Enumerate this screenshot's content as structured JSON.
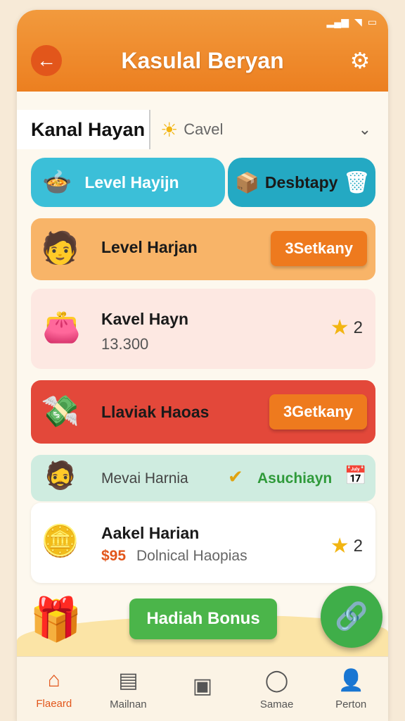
{
  "header": {
    "title": "Kasulal Beryan",
    "back_icon": "arrow-left-icon",
    "settings_icon": "gear-icon"
  },
  "selector": {
    "title": "Kanal Hayan",
    "label": "Cavel",
    "icon": "sun-icon"
  },
  "pills": [
    {
      "label": "Level Hayijn",
      "icon": "bowl-icon",
      "color": "#3bbfd8"
    },
    {
      "label": "Desbtapy",
      "icon": "box-icon",
      "color": "#24a9c3"
    }
  ],
  "cards": [
    {
      "title": "Level Harjan",
      "button": "3Setkany",
      "color": "#f7b264"
    },
    {
      "title": "Kavel Hayn",
      "value": "13.300",
      "rating": "2",
      "color": "#fde8e2"
    },
    {
      "title": "Llaviak Haoas",
      "button": "3Getkany",
      "color": "#e3483a"
    },
    {
      "title": "Mevai Harnia",
      "tag": "Asuchiayn",
      "color": "#cfece0"
    },
    {
      "title": "Aakel Harian",
      "price": "$95",
      "subtitle": "Dolnical Haopias",
      "rating": "2",
      "color": "#ffffff"
    }
  ],
  "bonus": {
    "label": "Hadiah Bonus"
  },
  "nav": [
    {
      "label": "Flaeard",
      "icon": "home-icon",
      "active": true
    },
    {
      "label": "Mailnan",
      "icon": "doc-icon",
      "active": false
    },
    {
      "label": "",
      "icon": "box-icon",
      "active": false
    },
    {
      "label": "Samae",
      "icon": "search-icon",
      "active": false
    },
    {
      "label": "Perton",
      "icon": "person-icon",
      "active": false
    }
  ]
}
